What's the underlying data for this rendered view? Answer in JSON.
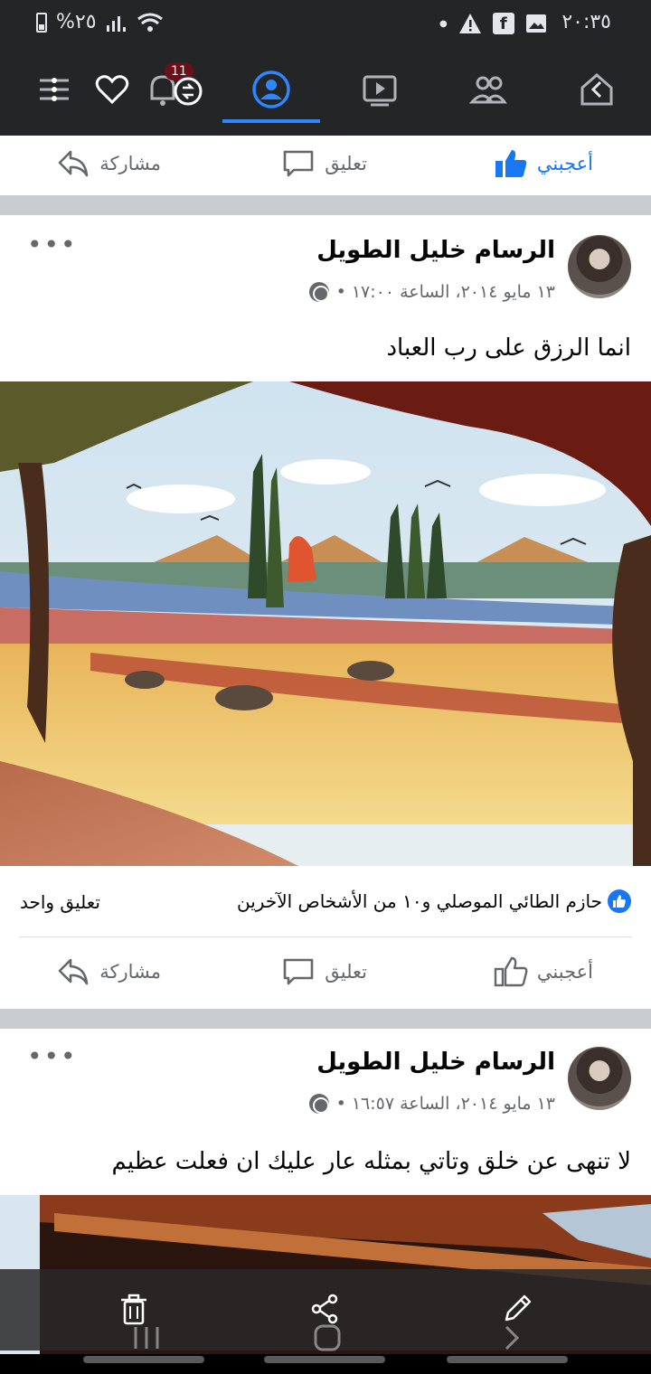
{
  "status_bar": {
    "battery_percent": "%٢٥",
    "time": "٢٠:٣٥",
    "notification_icons": [
      "warning-icon",
      "facebook-icon",
      "image-icon"
    ]
  },
  "nav": {
    "items": [
      "home-icon",
      "friends-icon",
      "watch-icon",
      "profile-icon",
      "notifications-icon",
      "menu-icon"
    ],
    "notification_badge": "11",
    "active": "profile-icon",
    "accent_color": "#2d88ff"
  },
  "top_actions": {
    "like_label": "أعجبني",
    "comment_label": "تعليق",
    "share_label": "مشاركة"
  },
  "posts": [
    {
      "author": "الرسام خليل الطويل",
      "meta": "١٣ مايو ٢٠١٤، الساعة ١٧:٠٠ •",
      "text": "انما الرزق على رب العباد",
      "likes": "حازم الطائي الموصلي و١٠ من الأشخاص الآخرين",
      "comments": "تعليق واحد",
      "like_label": "أعجبني",
      "comment_label": "تعليق",
      "share_label": "مشاركة"
    },
    {
      "author": "الرسام خليل الطويل",
      "meta": "١٣ مايو ٢٠١٤، الساعة ١٦:٥٧ •",
      "text": "لا تنهى عن خلق وتاتي بمثله عار عليك ان فعلت عظيم"
    }
  ],
  "colors": {
    "brand_blue": "#1877f2",
    "dark_bar": "#242526",
    "separator": "#c9ccd1"
  }
}
